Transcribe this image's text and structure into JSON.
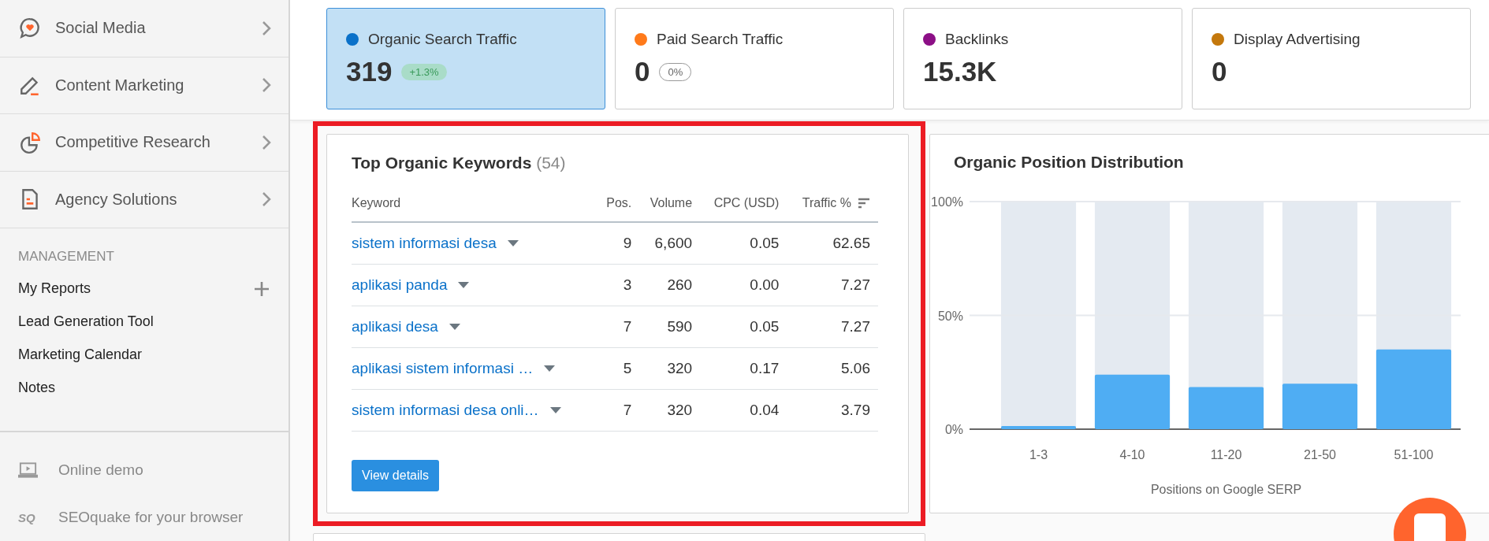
{
  "sidebar": {
    "nav_items": [
      {
        "label": "Social Media"
      },
      {
        "label": "Content Marketing"
      },
      {
        "label": "Competitive Research"
      },
      {
        "label": "Agency Solutions"
      }
    ],
    "section_title": "MANAGEMENT",
    "management_items": [
      {
        "label": "My Reports",
        "addable": true
      },
      {
        "label": "Lead Generation Tool",
        "addable": false
      },
      {
        "label": "Marketing Calendar",
        "addable": false
      },
      {
        "label": "Notes",
        "addable": false
      }
    ],
    "footer_items": [
      {
        "label": "Online demo"
      },
      {
        "label": "SEOquake for your browser",
        "icon_text": "SQ"
      }
    ]
  },
  "metric_cards": [
    {
      "label": "Organic Search Traffic",
      "value": "319",
      "selected": true,
      "color": "#0a71c9",
      "delta": {
        "text": "+1.3%",
        "kind": "up"
      }
    },
    {
      "label": "Paid Search Traffic",
      "value": "0",
      "selected": false,
      "color": "#ff7a1a",
      "delta": {
        "text": "0%",
        "kind": "neutral"
      }
    },
    {
      "label": "Backlinks",
      "value": "15.3K",
      "selected": false,
      "color": "#8c0f86"
    },
    {
      "label": "Display Advertising",
      "value": "0",
      "selected": false,
      "color": "#c4780c"
    }
  ],
  "keywords_panel": {
    "title": "Top Organic Keywords",
    "count": "(54)",
    "highlighted": true,
    "columns": [
      "Keyword",
      "Pos.",
      "Volume",
      "CPC (USD)",
      "Traffic %"
    ],
    "rows": [
      [
        "sistem informasi desa",
        "9",
        "6,600",
        "0.05",
        "62.65"
      ],
      [
        "aplikasi panda",
        "3",
        "260",
        "0.00",
        "7.27"
      ],
      [
        "aplikasi desa",
        "7",
        "590",
        "0.05",
        "7.27"
      ],
      [
        "aplikasi sistem informasi …",
        "5",
        "320",
        "0.17",
        "5.06"
      ],
      [
        "sistem informasi desa onli…",
        "7",
        "320",
        "0.04",
        "3.79"
      ]
    ],
    "button": "View details"
  },
  "position_panel": {
    "title": "Organic Position Distribution",
    "chart_data": {
      "type": "bar",
      "xlabel": "Positions on Google SERP",
      "categories": [
        "1-3",
        "4-10",
        "11-20",
        "21-50",
        "51-100"
      ],
      "values": [
        1.4,
        24,
        18.5,
        20,
        35
      ],
      "ylim": [
        0,
        100
      ],
      "yticks": [
        {
          "value": 0,
          "label": "0%"
        },
        {
          "value": 50,
          "label": "50%"
        },
        {
          "value": 100,
          "label": "100%"
        }
      ]
    }
  }
}
